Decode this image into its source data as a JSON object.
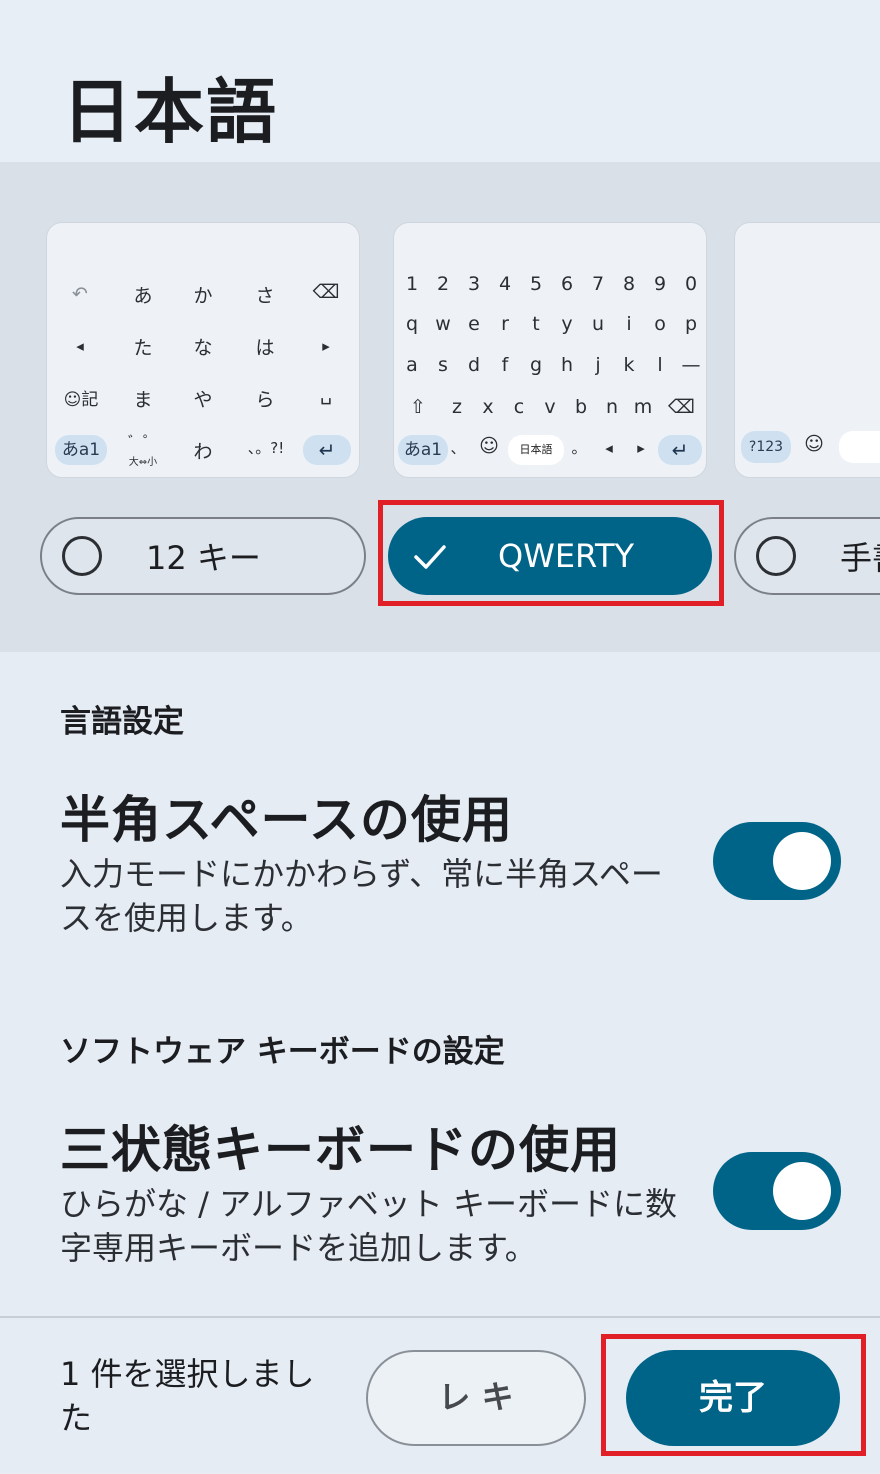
{
  "header": {
    "title": "日本語"
  },
  "layouts": {
    "twelve_key": {
      "rows": [
        [
          "↶",
          "あ",
          "か",
          "さ",
          "⌫"
        ],
        [
          "◂",
          "た",
          "な",
          "は",
          "▸"
        ],
        [
          "☺記",
          "ま",
          "や",
          "ら",
          "␣"
        ],
        [
          "あa1",
          "゛゜",
          "わ",
          "、。?!",
          "↵"
        ]
      ],
      "small_hint": "大⇔小"
    },
    "qwerty": {
      "num_row": [
        "1",
        "2",
        "3",
        "4",
        "5",
        "6",
        "7",
        "8",
        "9",
        "0"
      ],
      "row1": [
        "q",
        "w",
        "e",
        "r",
        "t",
        "y",
        "u",
        "i",
        "o",
        "p"
      ],
      "row2": [
        "a",
        "s",
        "d",
        "f",
        "g",
        "h",
        "j",
        "k",
        "l",
        "—"
      ],
      "row3": [
        "⇧",
        "z",
        "x",
        "c",
        "v",
        "b",
        "n",
        "m",
        "⌫"
      ],
      "bottom": {
        "mode": "あa1",
        "comma": "、",
        "emoji": "☺",
        "space": "日本語",
        "period": "。",
        "left": "◂",
        "right": "▸",
        "enter": "↵"
      }
    },
    "third": {
      "sym": "?123",
      "emoji": "☺"
    },
    "options": [
      {
        "label": "12 キー",
        "selected": false
      },
      {
        "label": "QWERTY",
        "selected": true
      },
      {
        "label": "手書",
        "selected": false
      }
    ]
  },
  "sections": [
    {
      "heading": "言語設定",
      "setting": {
        "title": "半角スペースの使用",
        "description": "入力モードにかかわらず、常に半角スペースを使用します。",
        "enabled": true
      }
    },
    {
      "heading": "ソフトウェア キーボードの設定",
      "setting": {
        "title": "三状態キーボードの使用",
        "description": "ひらがな / アルファベット キーボードに数字専用キーボードを追加します。",
        "enabled": true
      }
    }
  ],
  "footer": {
    "status": "1 件を選択しました",
    "secondary_label": "レ キ",
    "done_label": "完了"
  },
  "colors": {
    "accent": "#006488",
    "highlight": "#e01f26",
    "background": "#e6ecf4"
  }
}
